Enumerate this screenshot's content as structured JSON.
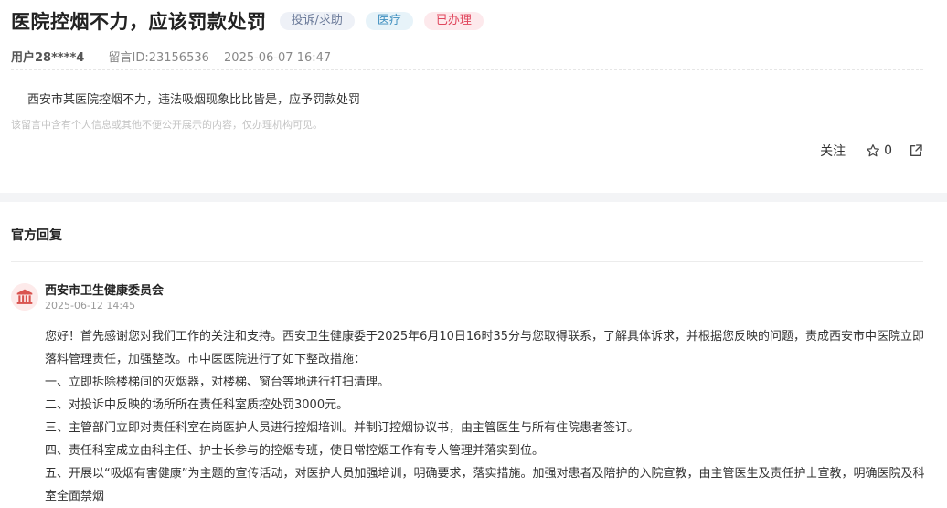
{
  "post": {
    "title": "医院控烟不力，应该罚款处罚",
    "tags": [
      "投诉/求助",
      "医疗",
      "已办理"
    ],
    "user": "用户28****4",
    "message_id": "留言ID:23156536",
    "datetime": "2025-06-07 16:47",
    "content": "西安市某医院控烟不力，违法吸烟现象比比皆是，应予罚款处罚",
    "privacy_note": "该留言中含有个人信息或其他不便公开展示的内容，仅办理机构可见。"
  },
  "actions": {
    "follow_label": "关注",
    "star_count": "0",
    "icons": [
      "star-icon",
      "share-icon"
    ]
  },
  "reply": {
    "section_title": "官方回复",
    "org": "西安市卫生健康委员会",
    "date": "2025-06-12 14:45",
    "avatar_icon": "government-building-icon",
    "paragraphs": [
      "您好！首先感谢您对我们工作的关注和支持。西安卫生健康委于2025年6月10日16时35分与您取得联系，了解具体诉求，并根据您反映的问题，责成西安市中医院立即落料管理责任，加强整改。市中医医院进行了如下整改措施：",
      "一、立即拆除楼梯间的灭烟器，对楼梯、窗台等地进行打扫清理。",
      "二、对投诉中反映的场所所在责任科室质控处罚3000元。",
      "三、主管部门立即对责任科室在岗医护人员进行控烟培训。并制订控烟协议书，由主管医生与所有住院患者签订。",
      "四、责任科室成立由科主任、护士长参与的控烟专班，使日常控烟工作有专人管理并落实到位。",
      "五、开展以“吸烟有害健康”为主题的宣传活动，对医护人员加强培训，明确要求，落实措施。加强对患者及陪护的入院宣教，由主管医生及责任护士宣教，明确医院及科室全面禁烟"
    ]
  },
  "colors": {
    "tag_category_bg": "#eef1f7",
    "tag_field_bg": "#e7f3f9",
    "tag_status_bg": "#fde9ec",
    "tag_status_text": "#e0465d",
    "avatar_bg": "#fdeaea",
    "avatar_icon": "#d9534f"
  }
}
